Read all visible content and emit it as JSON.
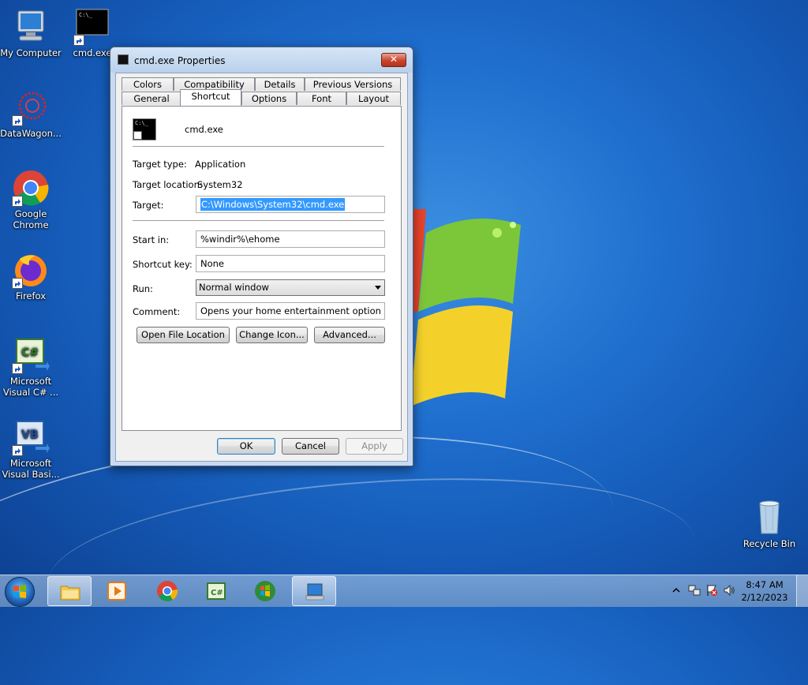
{
  "desktop": {
    "icons": [
      {
        "label": "My Computer"
      },
      {
        "label": "cmd.exe"
      },
      {
        "label": "DataWagon..."
      },
      {
        "label": "Google Chrome"
      },
      {
        "label": "Firefox"
      },
      {
        "label": "Microsoft Visual C# ..."
      },
      {
        "label": "Microsoft Visual Basi..."
      },
      {
        "label": "Recycle Bin"
      }
    ]
  },
  "dialog": {
    "title": "cmd.exe Properties",
    "close_glyph": "✕",
    "tabs_row1": [
      "Colors",
      "Compatibility",
      "Details",
      "Previous Versions"
    ],
    "tabs_row2": [
      "General",
      "Shortcut",
      "Options",
      "Font",
      "Layout"
    ],
    "active_tab": "Shortcut",
    "app_name": "cmd.exe",
    "icon_text": "C:\\_",
    "target_type_label": "Target type:",
    "target_type_value": "Application",
    "target_location_label": "Target location:",
    "target_location_value": "System32",
    "target_label": "Target:",
    "target_value": "C:\\Windows\\System32\\cmd.exe",
    "start_in_label": "Start in:",
    "start_in_value": "%windir%\\ehome",
    "shortcut_key_label": "Shortcut key:",
    "shortcut_key_value": "None",
    "run_label": "Run:",
    "run_value": "Normal window",
    "comment_label": "Comment:",
    "comment_value": "Opens your home entertainment option for digita",
    "open_file_location": "Open File Location",
    "change_icon": "Change Icon...",
    "advanced": "Advanced...",
    "ok": "OK",
    "cancel": "Cancel",
    "apply": "Apply"
  },
  "taskbar": {
    "clock_time": "8:47 AM",
    "clock_date": "2/12/2023"
  }
}
